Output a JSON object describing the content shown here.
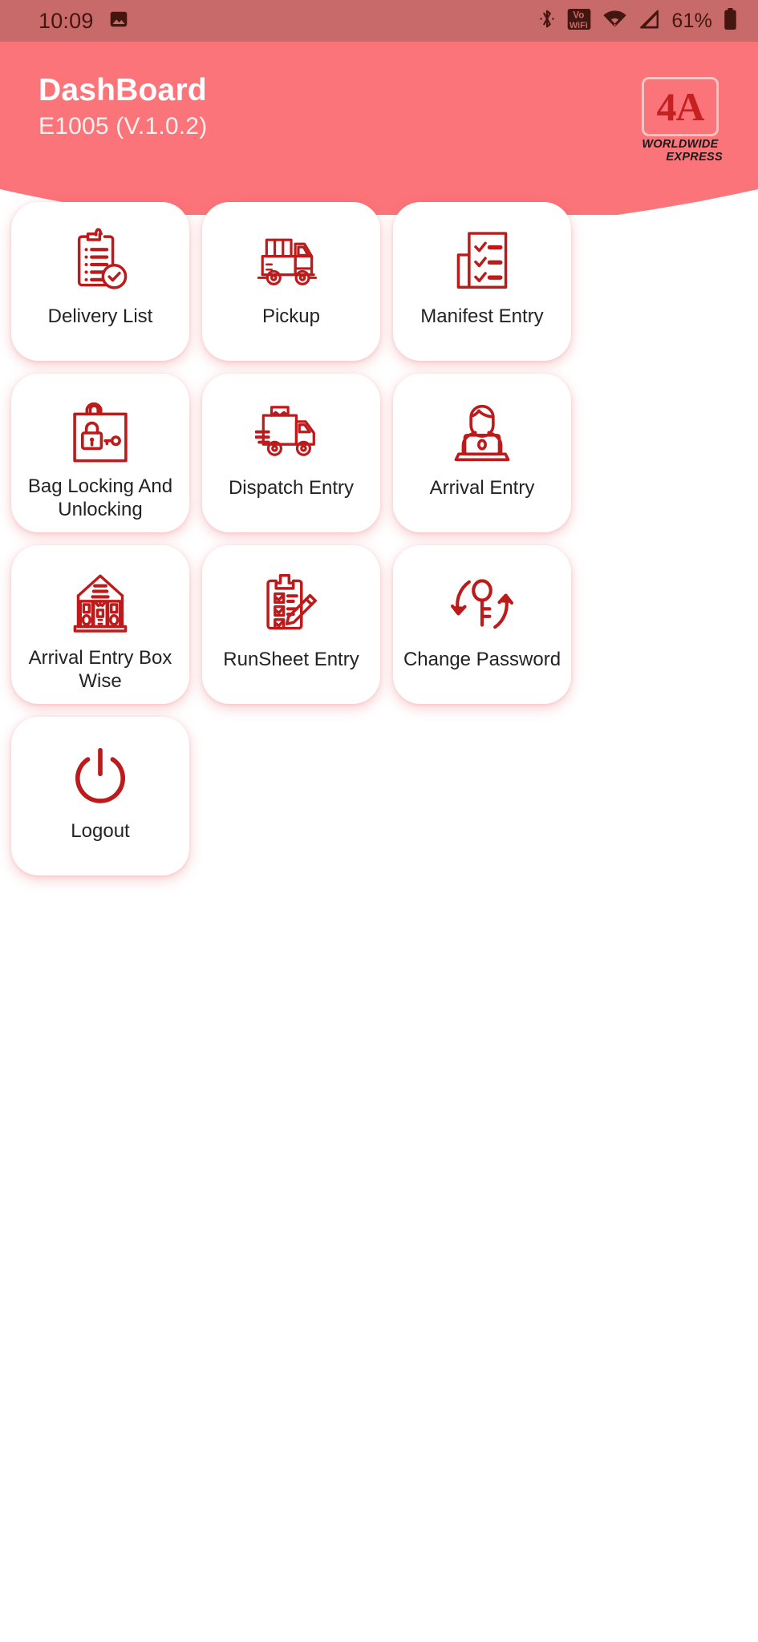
{
  "status_bar": {
    "time": "10:09",
    "battery_percent": "61%",
    "icons": [
      "image-icon",
      "bluetooth-icon",
      "vowifi-icon",
      "wifi-icon",
      "cellular-signal-icon",
      "battery-icon"
    ],
    "background_color": "#c96a6a"
  },
  "header": {
    "title": "DashBoard",
    "subtitle": "E1005 (V.1.0.2)",
    "background_color": "#fb7479",
    "logo": {
      "mark": "4A",
      "line1": "WORLDWIDE",
      "line2": "EXPRESS"
    }
  },
  "theme": {
    "accent": "#fb7479",
    "icon_red": "#bd1b1b",
    "card_bg": "#ffffff",
    "text": "#232323"
  },
  "grid": {
    "items": [
      {
        "label": "Delivery List",
        "icon": "clipboard-check-icon"
      },
      {
        "label": "Pickup",
        "icon": "pickup-truck-icon"
      },
      {
        "label": "Manifest Entry",
        "icon": "checklist-document-icon"
      },
      {
        "label": "Bag Locking And Unlocking",
        "icon": "bag-lock-key-icon"
      },
      {
        "label": "Dispatch Entry",
        "icon": "delivery-truck-box-icon"
      },
      {
        "label": "Arrival Entry",
        "icon": "person-laptop-icon"
      },
      {
        "label": "Arrival Entry Box Wise",
        "icon": "warehouse-building-icon"
      },
      {
        "label": "RunSheet Entry",
        "icon": "clipboard-pencil-icon"
      },
      {
        "label": "Change Password",
        "icon": "key-refresh-icon"
      },
      {
        "label": "Logout",
        "icon": "power-icon"
      }
    ]
  }
}
